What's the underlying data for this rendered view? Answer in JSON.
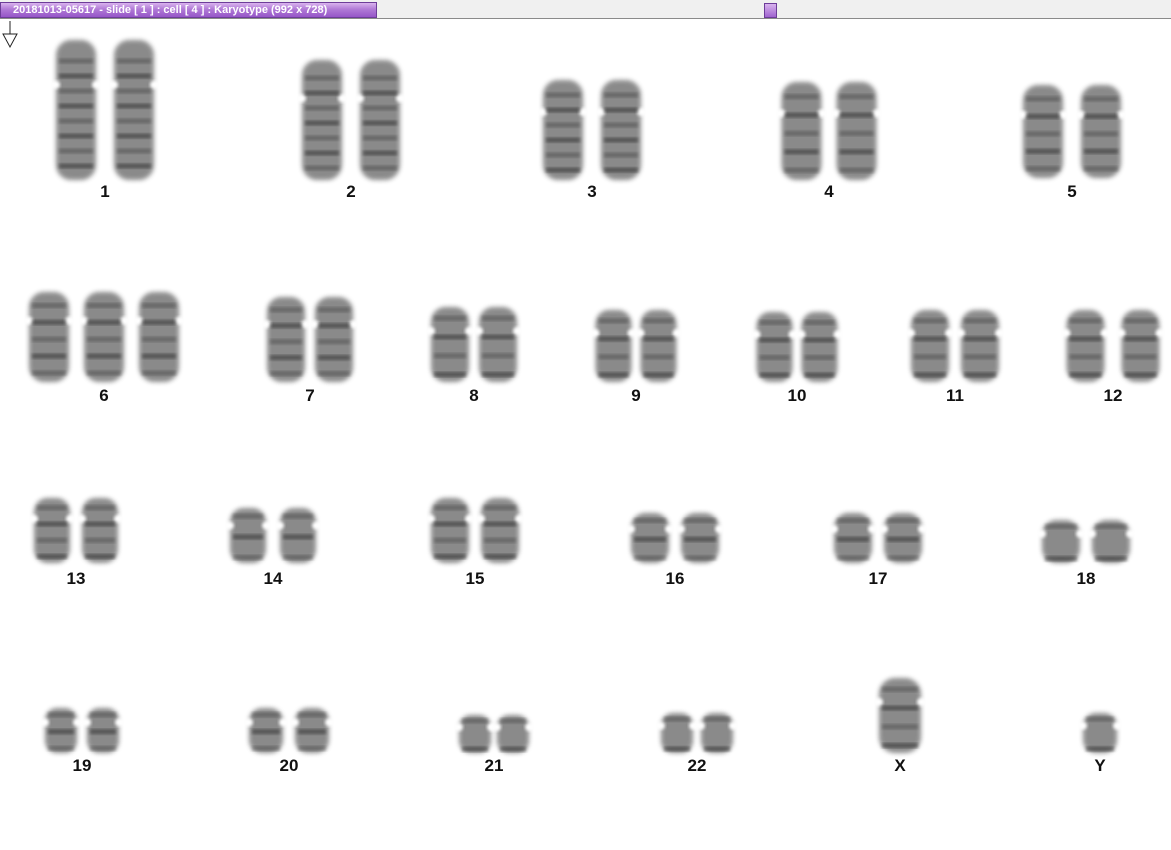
{
  "window": {
    "title": "20181013-05617 - slide [ 1 ] : cell [ 4 ] : Karyotype  (992 x 728)"
  },
  "karyotype": {
    "groups": [
      {
        "label": "1",
        "count": 2
      },
      {
        "label": "2",
        "count": 2
      },
      {
        "label": "3",
        "count": 2
      },
      {
        "label": "4",
        "count": 2
      },
      {
        "label": "5",
        "count": 2
      },
      {
        "label": "6",
        "count": 3
      },
      {
        "label": "7",
        "count": 2
      },
      {
        "label": "8",
        "count": 2
      },
      {
        "label": "9",
        "count": 2
      },
      {
        "label": "10",
        "count": 2
      },
      {
        "label": "11",
        "count": 2
      },
      {
        "label": "12",
        "count": 2
      },
      {
        "label": "13",
        "count": 2
      },
      {
        "label": "14",
        "count": 2
      },
      {
        "label": "15",
        "count": 2
      },
      {
        "label": "16",
        "count": 2
      },
      {
        "label": "17",
        "count": 2
      },
      {
        "label": "18",
        "count": 2
      },
      {
        "label": "19",
        "count": 2
      },
      {
        "label": "20",
        "count": 2
      },
      {
        "label": "21",
        "count": 2
      },
      {
        "label": "22",
        "count": 2
      },
      {
        "label": "X",
        "count": 1
      },
      {
        "label": "Y",
        "count": 1
      }
    ],
    "marker_icon": "down-arrow-icon",
    "colors": {
      "chromosome": "#5a5a5a",
      "band": "#2a2a2a",
      "accent": "#9a5ccc"
    }
  }
}
